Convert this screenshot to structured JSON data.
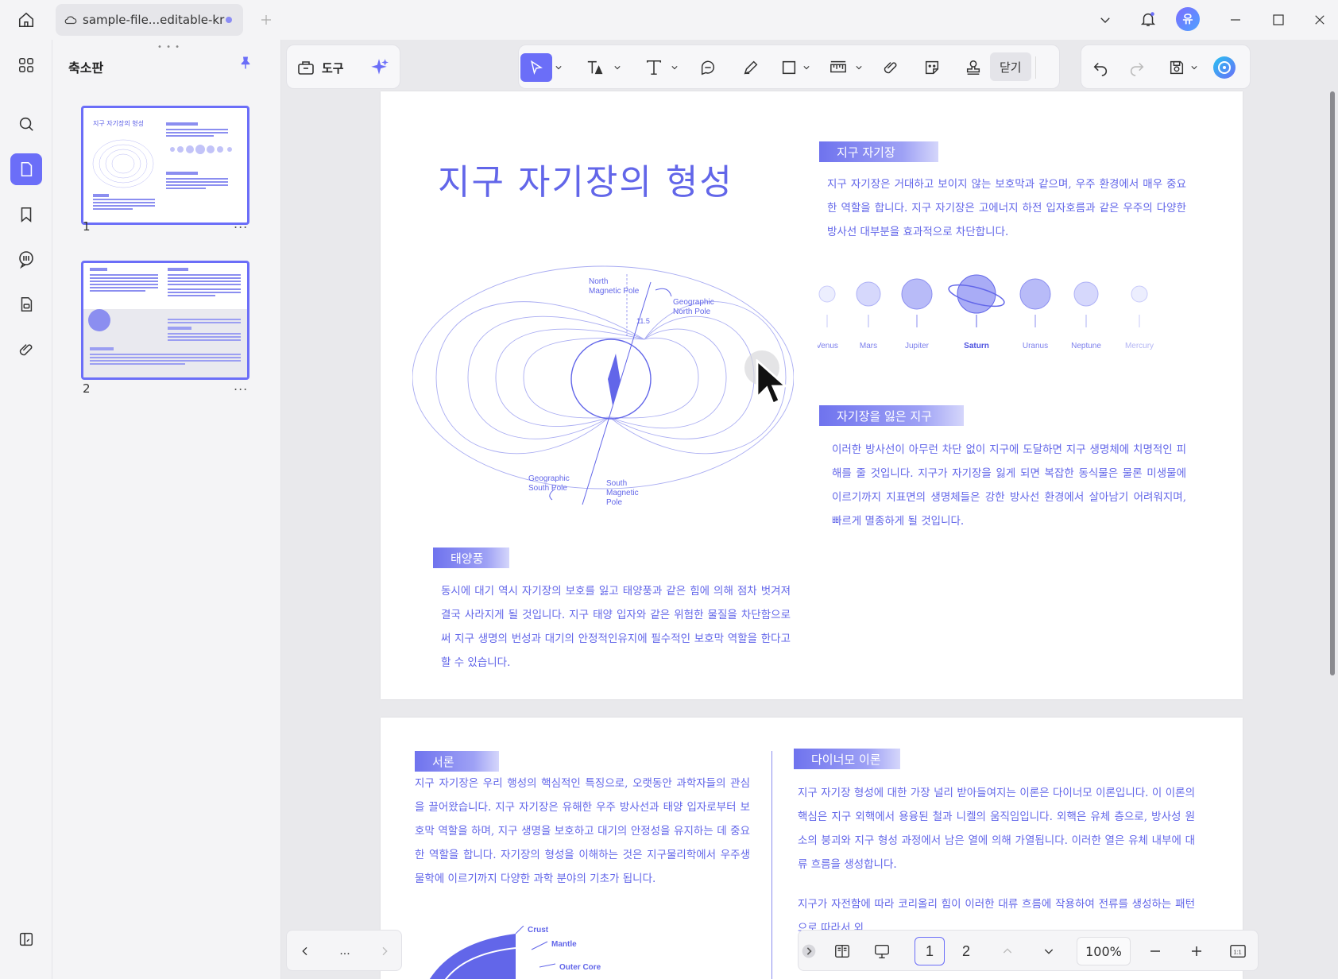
{
  "window": {
    "tab_title": "sample-file...editable-kr",
    "avatar_initial": "유"
  },
  "left_panel": {
    "title": "축소판",
    "pages": [
      {
        "number": "1",
        "more": "..."
      },
      {
        "number": "2",
        "more": "..."
      }
    ]
  },
  "toolbar": {
    "tools_label": "도구",
    "close_label": "닫기"
  },
  "page1": {
    "title": "지구 자기장의 형성",
    "sections": [
      {
        "heading": "지구 자기장",
        "body": "지구 자기장은 거대하고 보이지 않는 보호막과 같으며, 우주 환경에서 매우 중요한 역할을 합니다. 지구 자기장은 고에너지 하전 입자호름과 같은 우주의 다양한 방사선 대부분을 효과적으로 차단합니다."
      },
      {
        "heading": "자기장을 잃은 지구",
        "body": "이러한 방사선이 아무런 차단 없이 지구에 도달하면 지구 생명체에 치명적인 피해를 줄 것입니다. 지구가 자기장을 잃게 되면 복잡한 동식물은 물론 미생물에 이르기까지 지표면의 생명체들은 강한 방사선 환경에서 살아남기 어려워지며, 빠르게 멸종하게 될 것입니다."
      },
      {
        "heading": "태양풍",
        "body": "동시에 대기 역시 자기장의 보호를 잃고 태양풍과 같은 힘에 의해 점차 벗겨져 결국 사라지게 될 것입니다. 지구 태양 입자와 같은 위험한 물질을 차단함으로써 지구 생명의 번성과 대기의 안정적인유지에 필수적인 보호막 역할을 한다고 할 수 있습니다."
      }
    ],
    "diagram_labels": {
      "north_magnetic": [
        "North",
        "Magnetic Pole"
      ],
      "geo_north": [
        "Geographic",
        "North Pole"
      ],
      "geo_south": [
        "Geographic",
        "South Pole"
      ],
      "south_magnetic": [
        "South",
        "Magnetic",
        "Pole"
      ],
      "angle": "11.5"
    },
    "planets": [
      "Venus",
      "Mars",
      "Jupiter",
      "Saturn",
      "Uranus",
      "Neptune",
      "Mercury"
    ]
  },
  "page2": {
    "sections": [
      {
        "heading": "서론",
        "body": "지구 자기장은 우리 행성의 핵심적인 특징으로, 오랫동안 과학자들의 관심을 끌어왔습니다. 지구 자기장은 유해한 우주 방사선과 태양 입자로부터 보호막 역할을 하며, 지구 생명을 보호하고 대기의 안정성을 유지하는 데 중요한 역할을 합니다. 자기장의 형성을 이해하는 것은 지구물리학에서 우주생물학에 이르기까지 다양한 과학 분야의 기초가 됩니다."
      },
      {
        "heading": "다이너모 이론",
        "body": "지구 자기장 형성에 대한 가장 널리 받아들여지는 이론은 다이너모 이론입니다. 이 이론의 핵심은 지구 외핵에서 용융된 철과 니켈의 움직임입니다. 외핵은 유체 층으로, 방사성 원소의 붕괴와 지구 형성 과정에서 남은 열에 의해 가열됩니다. 이러한 열은 유체 내부에 대류 흐름을 생성합니다.",
        "body2": "지구가 자전함에 따라 코리올리 힘이 이러한 대류 흐름에 작용하여 전류를 생성하는 패턴으로 따라서 외"
      }
    ],
    "diagram_labels": [
      "Crust",
      "Mantle",
      "Outer Core"
    ]
  },
  "bottom_bar": {
    "more": "...",
    "page_buttons": [
      "1",
      "2"
    ],
    "zoom": "100%"
  },
  "colors": {
    "accent": "#6b6ef8",
    "doc_text": "#6266e9"
  }
}
